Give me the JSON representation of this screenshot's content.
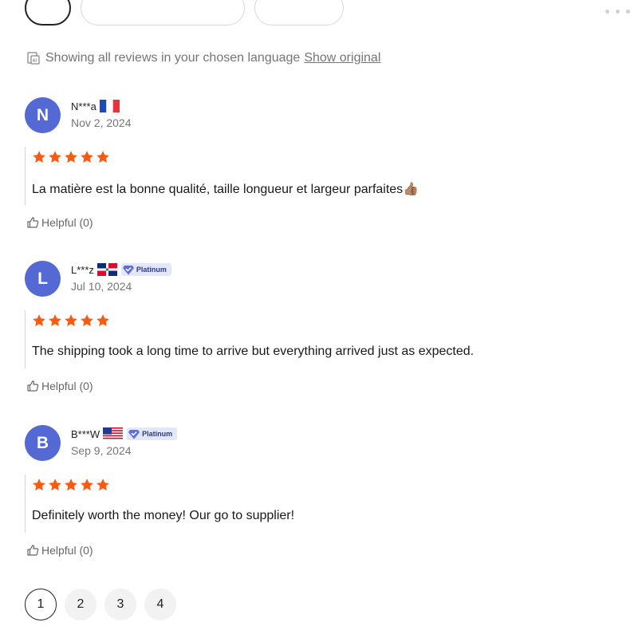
{
  "language_notice": {
    "text": "Showing all reviews in your chosen language",
    "link": "Show original"
  },
  "reviews": [
    {
      "initial": "N",
      "name": "N***a",
      "flag": "france",
      "badge": "",
      "date": "Nov 2, 2024",
      "rating": 5,
      "text": "La matière est la bonne qualité, taille longueur et largeur parfaites👍🏽",
      "helpful": "Helpful (0)"
    },
    {
      "initial": "L",
      "name": "L***z",
      "flag": "dominican-republic",
      "badge": "Platinum",
      "date": "Jul 10, 2024",
      "rating": 5,
      "text": "The shipping took a long time to arrive but everything arrived just as expected.",
      "helpful": "Helpful (0)"
    },
    {
      "initial": "B",
      "name": "B***W",
      "flag": "united-states",
      "badge": "Platinum",
      "date": "Sep 9, 2024",
      "rating": 5,
      "text": "Definitely worth the money! Our go to supplier!",
      "helpful": "Helpful (0)"
    }
  ],
  "pagination": {
    "pages": [
      "1",
      "2",
      "3",
      "4"
    ],
    "current": "1"
  },
  "colors": {
    "avatar": "#5469d4",
    "star": "#fd5a0f",
    "badge_bg": "#e2e8fa",
    "badge_icon": "#5b6ee0"
  }
}
